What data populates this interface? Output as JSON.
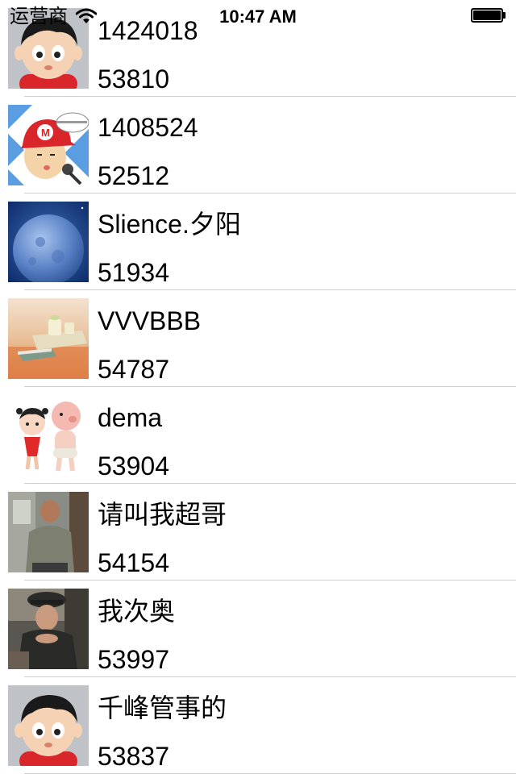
{
  "status_bar": {
    "carrier": "运营商",
    "time": "10:47 AM",
    "icons": [
      "wifi-icon",
      "battery-icon"
    ]
  },
  "list": {
    "rows": [
      {
        "name": "1424018",
        "score": "53810",
        "avatar": "cartoon-boy-avatar"
      },
      {
        "name": "1408524",
        "score": "52512",
        "avatar": "cartoon-mario-cap-avatar"
      },
      {
        "name": "Slience.夕阳",
        "score": "51934",
        "avatar": "moon-avatar"
      },
      {
        "name": "VVVBBB",
        "score": "54787",
        "avatar": "tea-set-photo-avatar"
      },
      {
        "name": "dema",
        "score": "53904",
        "avatar": "cartoon-couple-avatar"
      },
      {
        "name": "请叫我超哥",
        "score": "54154",
        "avatar": "man-photo-avatar"
      },
      {
        "name": "我次奥",
        "score": "53997",
        "avatar": "woman-in-cap-photo-avatar"
      },
      {
        "name": "千峰管事的",
        "score": "53837",
        "avatar": "cartoon-boy-avatar"
      }
    ]
  }
}
